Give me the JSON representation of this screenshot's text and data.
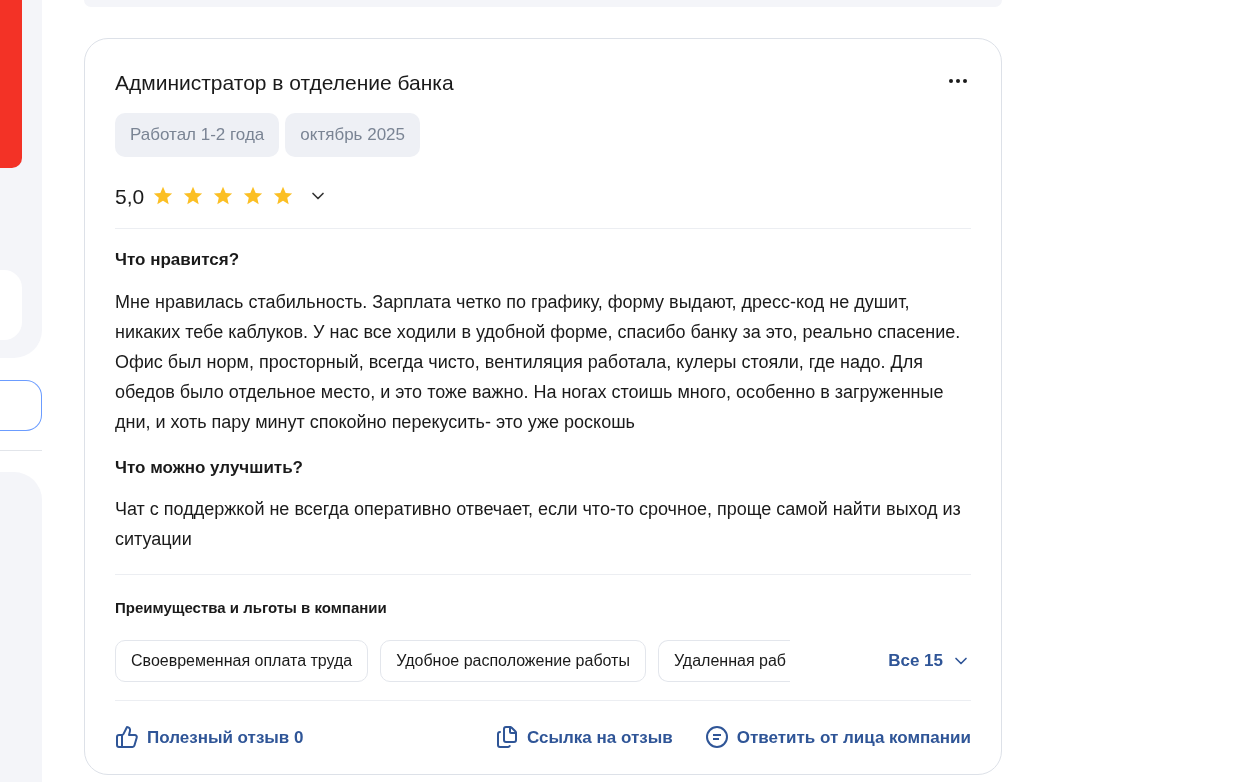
{
  "review": {
    "title": "Администратор в отделение банка",
    "tags": [
      "Работал 1-2 года",
      "октябрь 2025"
    ],
    "rating": "5,0",
    "stars": 5,
    "sections": [
      {
        "heading": "Что нравится?",
        "text": "Мне нравилась стабильность. Зарплата четко по графику, форму выдают, дресс-код не душит, никаких тебе каблуков. У нас все ходили в удобной форме, спасибо банку за это, реально спасение. Офис был норм, просторный, всегда чисто, вентиляция работала, кулеры стояли, где надо. Для обедов было отдельное место, и это тоже важно. На ногах стоишь много, особенно в загруженные дни, и хоть пару минут спокойно перекусить- это уже роскошь"
      },
      {
        "heading": "Что можно улучшить?",
        "text": "Чат с поддержкой не всегда оперативно отвечает, если что-то срочное, проще самой найти выход из ситуации"
      }
    ],
    "benefits": {
      "heading": "Преимущества и льготы в компании",
      "items": [
        "Своевременная оплата труда",
        "Удобное расположение работы",
        "Удаленная раб"
      ],
      "more": "Все 15"
    },
    "actions": [
      {
        "kind": "like",
        "label": "Полезный отзыв 0"
      },
      {
        "kind": "link",
        "label": "Ссылка на отзыв"
      },
      {
        "kind": "reply",
        "label": "Ответить от лица компании"
      }
    ]
  }
}
